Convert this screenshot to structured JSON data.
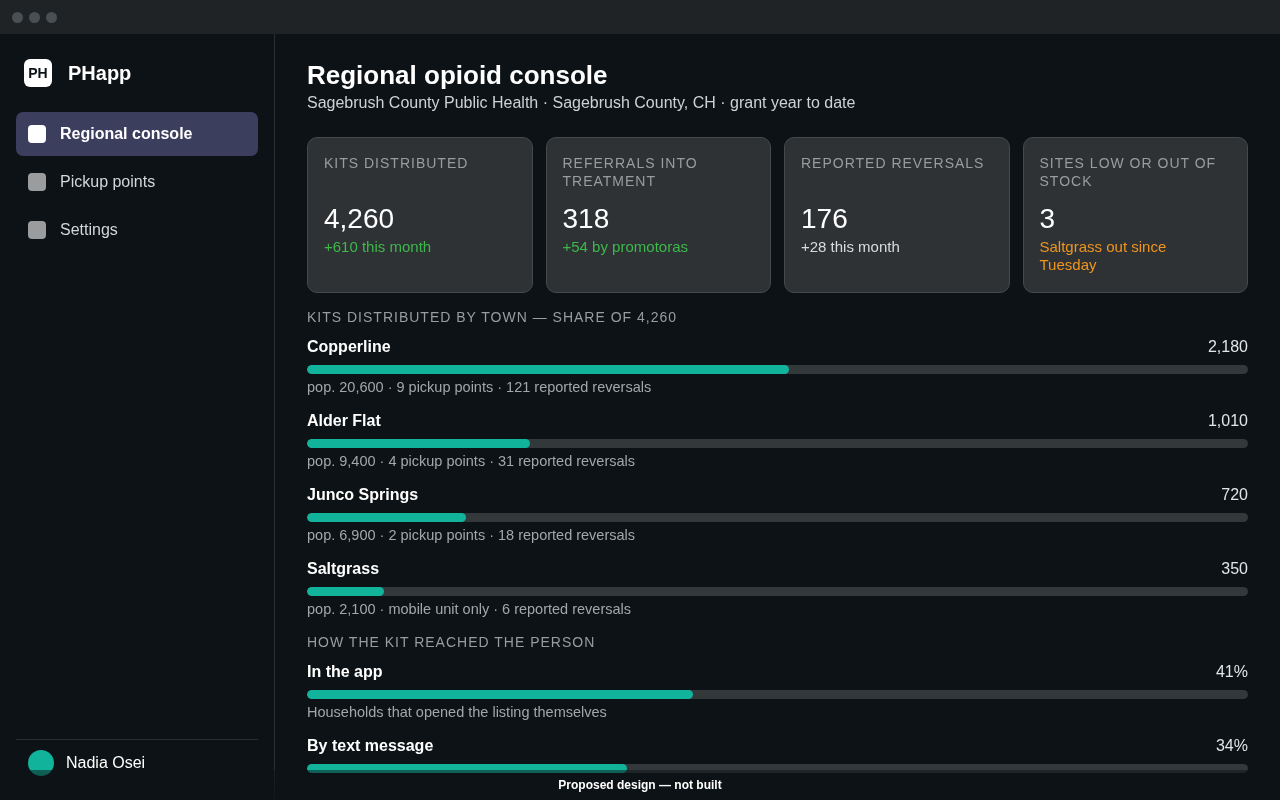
{
  "app": {
    "name": "PHapp",
    "logo": "PH"
  },
  "sidebar": {
    "items": [
      {
        "label": "Regional console",
        "selected": true
      },
      {
        "label": "Pickup points",
        "selected": false
      },
      {
        "label": "Settings",
        "selected": false
      }
    ],
    "user": {
      "name": "Nadia Osei"
    }
  },
  "page": {
    "title": "Regional opioid console",
    "subtitle": "Sagebrush County Public Health · Sagebrush County, CH · grant year to date"
  },
  "stats": [
    {
      "label": "KITS DISTRIBUTED",
      "value": "4,260",
      "note": "+610 this month",
      "color": "#3db84a"
    },
    {
      "label": "REFERRALS INTO TREATMENT",
      "value": "318",
      "note": "+54 by promotoras",
      "color": "#3db84a"
    },
    {
      "label": "REPORTED REVERSALS",
      "value": "176",
      "note": "+28 this month",
      "color": "#d9dbdc"
    },
    {
      "label": "SITES LOW OR OUT OF STOCK",
      "value": "3",
      "note": "Saltgrass out since Tuesday",
      "color": "#f0951d"
    }
  ],
  "sections": [
    {
      "heading": "KITS DISTRIBUTED BY TOWN — SHARE OF 4,260",
      "rows": [
        {
          "name": "Copperline",
          "value": "2,180",
          "level": 0.512,
          "caption": "pop. 20,600 · 9 pickup points · 121 reported reversals"
        },
        {
          "name": "Alder Flat",
          "value": "1,010",
          "level": 0.237,
          "caption": "pop. 9,400 · 4 pickup points · 31 reported reversals"
        },
        {
          "name": "Junco Springs",
          "value": "720",
          "level": 0.169,
          "caption": "pop. 6,900 · 2 pickup points · 18 reported reversals"
        },
        {
          "name": "Saltgrass",
          "value": "350",
          "level": 0.082,
          "caption": "pop. 2,100 · mobile unit only · 6 reported reversals"
        }
      ]
    },
    {
      "heading": "HOW THE KIT REACHED THE PERSON",
      "rows": [
        {
          "name": "In the app",
          "value": "41%",
          "level": 0.41,
          "caption": "Households that opened the listing themselves"
        },
        {
          "name": "By text message",
          "value": "34%",
          "level": 0.34
        }
      ]
    }
  ],
  "footer_note": "Proposed design — not built"
}
